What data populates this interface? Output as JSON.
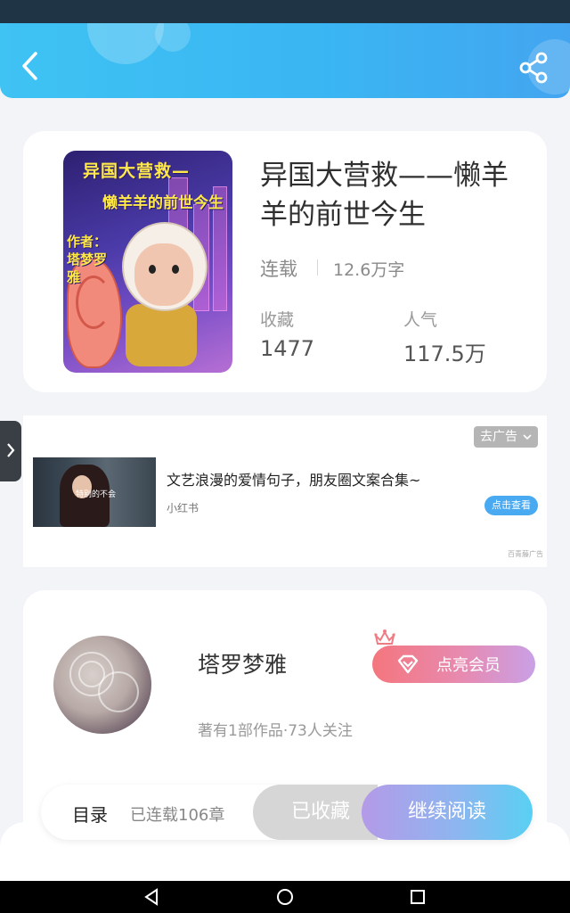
{
  "book": {
    "title": "异国大营救——懒羊羊的前世今生",
    "status": "连载",
    "word_count": "12.6万字",
    "collect_label": "收藏",
    "collect_value": "1477",
    "popularity_label": "人气",
    "popularity_value": "117.5万",
    "cover_text_title": "异国大营救—",
    "cover_text_subtitle": "懒羊羊的前世今生",
    "cover_text_author": "作者：塔梦罗雅"
  },
  "ad": {
    "close_label": "去广告",
    "title": "文艺浪漫的爱情句子，朋友圈文案合集~",
    "source": "小红书",
    "cta": "点击查看",
    "provider": "百青藤广告",
    "thumb_caption": "特别的不会"
  },
  "author": {
    "name": "塔罗梦雅",
    "stats": "著有1部作品·73人关注",
    "member_button": "点亮会员"
  },
  "action_bar": {
    "toc": "目录",
    "chapters": "已连载106章",
    "collected": "已收藏",
    "continue": "继续阅读"
  },
  "icons": {
    "back": "back-arrow-icon",
    "share": "share-icon",
    "side_tab": "chevron-right-icon",
    "ad_close": "chevron-down-icon",
    "member": "diamond-icon",
    "crown": "crown-icon",
    "nav_back": "triangle-back-icon",
    "nav_home": "circle-home-icon",
    "nav_recent": "square-recent-icon"
  },
  "colors": {
    "header_start": "#3fc3f3",
    "header_end": "#43a5f0",
    "member_start": "#f4767e",
    "member_end": "#c9a0e6",
    "read_start": "#b49ae8",
    "read_end": "#59d0f3",
    "ad_cta": "#49aaf2"
  }
}
